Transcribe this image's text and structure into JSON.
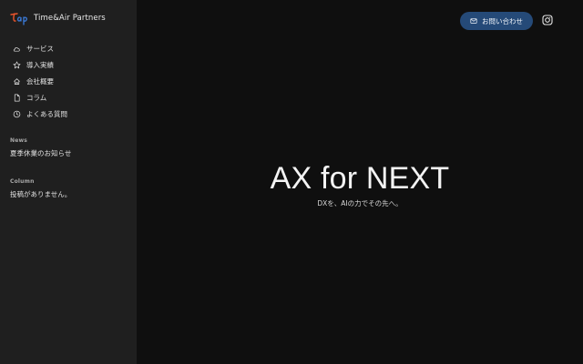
{
  "brand": {
    "name": "Time&Air Partners",
    "logo_colors": [
      "#e8542c",
      "#3b7bd9"
    ]
  },
  "nav": {
    "items": [
      {
        "label": "サービス",
        "icon": "cloud-icon"
      },
      {
        "label": "導入実績",
        "icon": "star-icon"
      },
      {
        "label": "会社概要",
        "icon": "home-icon"
      },
      {
        "label": "コラム",
        "icon": "document-icon"
      },
      {
        "label": "よくある質問",
        "icon": "clock-icon"
      }
    ]
  },
  "news": {
    "title": "News",
    "items": [
      "夏季休業のお知らせ"
    ]
  },
  "column": {
    "title": "Column",
    "empty": "投稿がありません。"
  },
  "header": {
    "contact_label": "お問い合わせ",
    "contact_icon": "mail-icon",
    "social_icon": "instagram-icon",
    "accent": "#254a78"
  },
  "hero": {
    "title": "AX for NEXT",
    "subtitle": "DXを、AIの力でその先へ。"
  }
}
